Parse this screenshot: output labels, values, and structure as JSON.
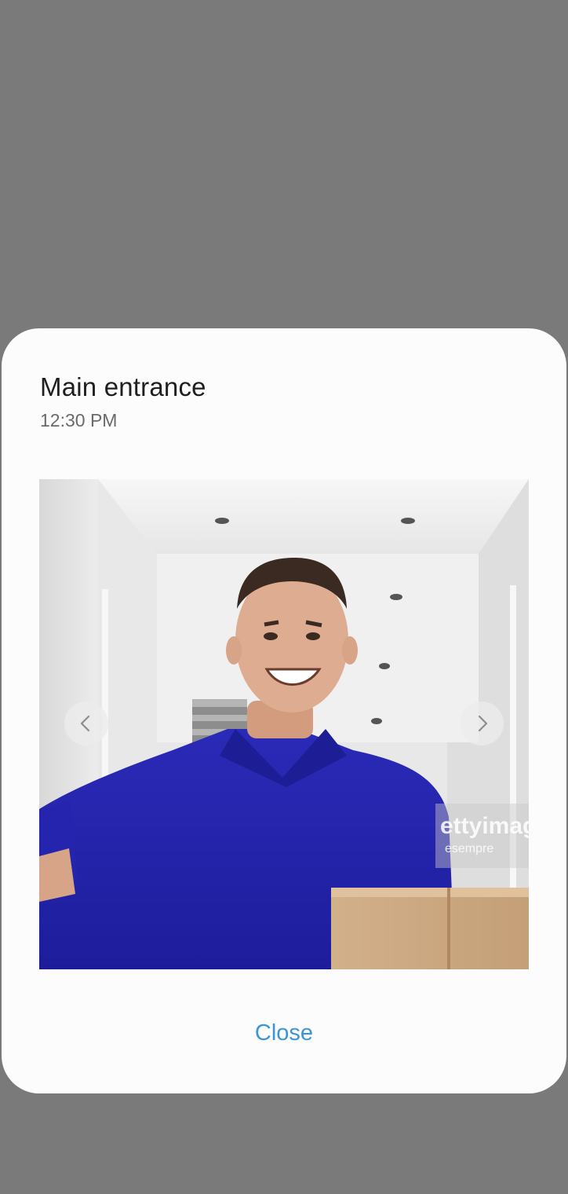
{
  "dialog": {
    "title": "Main entrance",
    "time": "12:30 PM",
    "snapshot": {
      "description": "doorbell camera snapshot",
      "watermark": "ettyimag",
      "watermark_sub": "esempre"
    },
    "prev_icon": "chevron-left-icon",
    "next_icon": "chevron-right-icon",
    "close_label": "Close"
  },
  "colors": {
    "overlay": "#7a7a7a",
    "dialog_bg": "#fcfcfc",
    "accent": "#3a95d6",
    "title": "#1f1f1f",
    "subtitle": "#6a6a6a"
  }
}
